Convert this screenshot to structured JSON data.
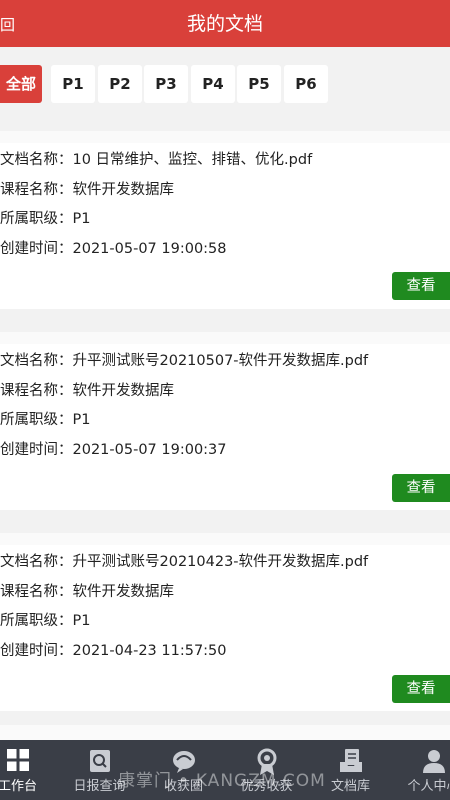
{
  "header": {
    "back_label": "回",
    "title": "我的文档"
  },
  "filters": [
    "全部",
    "P1",
    "P2",
    "P3",
    "P4",
    "P5",
    "P6"
  ],
  "labels": {
    "doc_name": "文档名称：",
    "course_name": "课程名称：",
    "level": "所属职级：",
    "created": "创建时间：",
    "view_button": "查看"
  },
  "documents": [
    {
      "doc_name": "10 日常维护、监控、排错、优化.pdf",
      "course_name": "软件开发数据库",
      "level": "P1",
      "created": "2021-05-07 19:00:58"
    },
    {
      "doc_name": "升平测试账号20210507-软件开发数据库.pdf",
      "course_name": "软件开发数据库",
      "level": "P1",
      "created": "2021-05-07 19:00:37"
    },
    {
      "doc_name": "升平测试账号20210423-软件开发数据库.pdf",
      "course_name": "软件开发数据库",
      "level": "P1",
      "created": "2021-04-23 11:57:50"
    }
  ],
  "tabbar": {
    "items": [
      {
        "label": "工作台",
        "icon": "grid-icon"
      },
      {
        "label": "日报查询",
        "icon": "report-search-icon"
      },
      {
        "label": "收获圈",
        "icon": "harvest-circle-icon"
      },
      {
        "label": "优秀收获",
        "icon": "medal-icon"
      },
      {
        "label": "文档库",
        "icon": "document-library-icon"
      },
      {
        "label": "个人中心",
        "icon": "user-icon"
      }
    ],
    "active_color": "#ffffff",
    "bg_color": "#3a3e47"
  },
  "watermark": "康掌门 • KANGZM.COM",
  "colors": {
    "brand_red": "#d9403a",
    "button_green": "#1f8a1f"
  }
}
